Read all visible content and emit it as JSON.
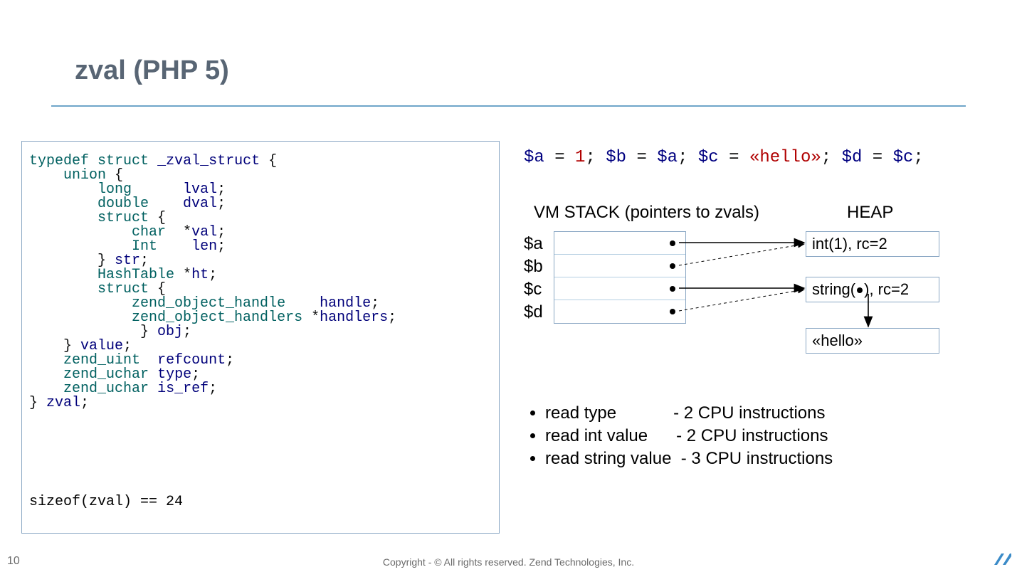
{
  "title": "zval (PHP 5)",
  "code_tokens": [
    [
      [
        "kw",
        "typedef"
      ],
      [
        "nm",
        " "
      ],
      [
        "kw",
        "struct"
      ],
      [
        "nm",
        " "
      ],
      [
        "id",
        "_zval_struct"
      ],
      [
        "nm",
        " {"
      ]
    ],
    [
      [
        "nm",
        "    "
      ],
      [
        "kw",
        "union"
      ],
      [
        "nm",
        " {"
      ]
    ],
    [
      [
        "nm",
        "        "
      ],
      [
        "kw",
        "long"
      ],
      [
        "nm",
        "      "
      ],
      [
        "id",
        "lval"
      ],
      [
        "nm",
        ";"
      ]
    ],
    [
      [
        "nm",
        "        "
      ],
      [
        "kw",
        "double"
      ],
      [
        "nm",
        "    "
      ],
      [
        "id",
        "dval"
      ],
      [
        "nm",
        ";"
      ]
    ],
    [
      [
        "nm",
        "        "
      ],
      [
        "kw",
        "struct"
      ],
      [
        "nm",
        " {"
      ]
    ],
    [
      [
        "nm",
        "            "
      ],
      [
        "kw",
        "char"
      ],
      [
        "nm",
        "  *"
      ],
      [
        "id",
        "val"
      ],
      [
        "nm",
        ";"
      ]
    ],
    [
      [
        "nm",
        "            "
      ],
      [
        "kw",
        "Int"
      ],
      [
        "nm",
        "    "
      ],
      [
        "id",
        "len"
      ],
      [
        "nm",
        ";"
      ]
    ],
    [
      [
        "nm",
        "        } "
      ],
      [
        "id",
        "str"
      ],
      [
        "nm",
        ";"
      ]
    ],
    [
      [
        "nm",
        "        "
      ],
      [
        "kw",
        "HashTable"
      ],
      [
        "nm",
        " *"
      ],
      [
        "id",
        "ht"
      ],
      [
        "nm",
        ";"
      ]
    ],
    [
      [
        "nm",
        "        "
      ],
      [
        "kw",
        "struct"
      ],
      [
        "nm",
        " {"
      ]
    ],
    [
      [
        "nm",
        "            "
      ],
      [
        "kw",
        "zend_object_handle"
      ],
      [
        "nm",
        "    "
      ],
      [
        "id",
        "handle"
      ],
      [
        "nm",
        ";"
      ]
    ],
    [
      [
        "nm",
        "            "
      ],
      [
        "kw",
        "zend_object_handlers"
      ],
      [
        "nm",
        " *"
      ],
      [
        "id",
        "handlers"
      ],
      [
        "nm",
        ";"
      ]
    ],
    [
      [
        "nm",
        "             } "
      ],
      [
        "id",
        "obj"
      ],
      [
        "nm",
        ";"
      ]
    ],
    [
      [
        "nm",
        "    } "
      ],
      [
        "id",
        "value"
      ],
      [
        "nm",
        ";"
      ]
    ],
    [
      [
        "nm",
        "    "
      ],
      [
        "kw",
        "zend_uint"
      ],
      [
        "nm",
        "  "
      ],
      [
        "id",
        "refcount"
      ],
      [
        "nm",
        ";"
      ]
    ],
    [
      [
        "nm",
        "    "
      ],
      [
        "kw",
        "zend_uchar"
      ],
      [
        "nm",
        " "
      ],
      [
        "id",
        "type"
      ],
      [
        "nm",
        ";"
      ]
    ],
    [
      [
        "nm",
        "    "
      ],
      [
        "kw",
        "zend_uchar"
      ],
      [
        "nm",
        " "
      ],
      [
        "id",
        "is_ref"
      ],
      [
        "nm",
        ";"
      ]
    ],
    [
      [
        "nm",
        "} "
      ],
      [
        "id",
        "zval"
      ],
      [
        "nm",
        ";"
      ]
    ]
  ],
  "sizeof_line": "sizeof(zval) == 24",
  "assign_tokens": [
    [
      "var",
      "$a"
    ],
    [
      "nm",
      " = "
    ],
    [
      "num",
      "1"
    ],
    [
      "nm",
      "; "
    ],
    [
      "var",
      "$b"
    ],
    [
      "nm",
      " = "
    ],
    [
      "var",
      "$a"
    ],
    [
      "nm",
      "; "
    ],
    [
      "var",
      "$c"
    ],
    [
      "nm",
      " = "
    ],
    [
      "str",
      "«hello»"
    ],
    [
      "nm",
      "; "
    ],
    [
      "var",
      "$d"
    ],
    [
      "nm",
      " = "
    ],
    [
      "var",
      "$c"
    ],
    [
      "nm",
      ";"
    ]
  ],
  "diagram": {
    "vm_label": "VM STACK (pointers to zvals)",
    "heap_label": "HEAP",
    "vars": [
      "$a",
      "$b",
      "$c",
      "$d"
    ],
    "heap_int": "int(1), rc=2",
    "heap_str_prefix": "string(",
    "heap_str_suffix": "), rc=2",
    "heap_hello": "«hello»"
  },
  "bullets": [
    "read type            - 2 CPU instructions",
    "read int value      - 2 CPU instructions",
    "read string value  - 3 CPU instructions"
  ],
  "page_number": "10",
  "copyright": "Copyright - © All rights reserved. Zend Technologies, Inc."
}
